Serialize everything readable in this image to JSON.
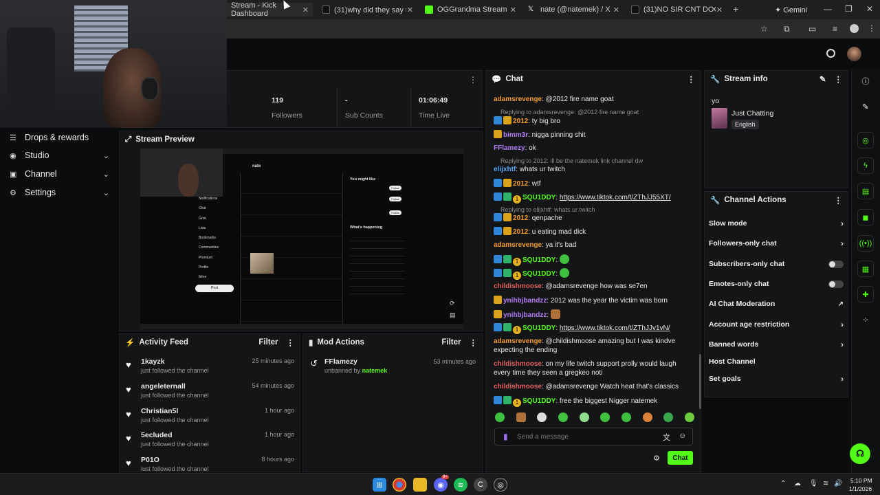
{
  "browser": {
    "tabs": [
      {
        "label": "Stream - Kick Dashboard",
        "icon": "kick-icon"
      },
      {
        "label": "(31)why did they say that 😂",
        "icon": "tiktok-icon"
      },
      {
        "label": "OGGrandma Stream - Watch",
        "icon": "kick-icon"
      },
      {
        "label": "nate (@natemek) / X",
        "icon": "x-icon"
      },
      {
        "label": "(31)NO SIR CNT DOOO | no",
        "icon": "tiktok-icon"
      }
    ],
    "gemini_label": "Gemini"
  },
  "sidebar": {
    "items": [
      {
        "label": "Drops & rewards",
        "icon": "gift-icon"
      },
      {
        "label": "Studio",
        "icon": "studio-icon"
      },
      {
        "label": "Channel",
        "icon": "channel-icon"
      },
      {
        "label": "Settings",
        "icon": "gear-icon"
      }
    ]
  },
  "stats": {
    "followers_value": "119",
    "followers_label": "Followers",
    "subs_value": "-",
    "subs_label": "Sub Counts",
    "time_value": "01:06:49",
    "time_label": "Time Live"
  },
  "stream_preview": {
    "title": "Stream Preview",
    "preview_profile_name": "nate",
    "preview_menu": [
      "Notifications",
      "Chat",
      "Grok",
      "Lists",
      "Bookmarks",
      "Communities",
      "Premium",
      "Profile",
      "More"
    ],
    "preview_post_button": "Post",
    "preview_you_might_like": "You might like",
    "preview_whats_happening": "What's happening",
    "preview_follow": "Follow"
  },
  "activity_feed": {
    "title": "Activity Feed",
    "filter_label": "Filter",
    "items": [
      {
        "name": "1kayzk",
        "action": "just followed the channel",
        "time": "25 minutes ago"
      },
      {
        "name": "angeleternall",
        "action": "just followed the channel",
        "time": "54 minutes ago"
      },
      {
        "name": "Christian5l",
        "action": "just followed the channel",
        "time": "1 hour ago"
      },
      {
        "name": "5ecluded",
        "action": "just followed the channel",
        "time": "1 hour ago"
      },
      {
        "name": "P01O",
        "action": "just followed the channel",
        "time": "8 hours ago"
      }
    ]
  },
  "mod_actions": {
    "title": "Mod Actions",
    "filter_label": "Filter",
    "items": [
      {
        "name": "FFlamezy",
        "action_prefix": "unbanned by",
        "moderator": "natemek",
        "time": "53 minutes ago"
      }
    ]
  },
  "chat": {
    "title": "Chat",
    "send_placeholder": "Send a message",
    "chat_button": "Chat",
    "messages": {
      "m1_user": "adamsrevenge",
      "m1_text": ": @2012 fire name goat",
      "m2_reply": "Replying to adamsrevenge: @2012 fire name goat",
      "m2_user": "2012",
      "m2_text": ": ty big bro",
      "m3_user": "bimm3r",
      "m3_text": ": nigga pinning shit",
      "m4_user": "FFlamezy",
      "m4_text": ": ok",
      "m5_reply": "Replying to 2012: ill be the natemek link channel dw",
      "m5_user": "elijxhtf",
      "m5_text": ": whats ur twitch",
      "m6_user": "2012",
      "m6_text": ": wtf",
      "m7_sub": "1",
      "m7_user": "SQU1DDY",
      "m7_link": "https://www.tiktok.com/t/ZThJJ55XT/",
      "m8_reply": "Replying to elijxhtf: whats ur twitch",
      "m8_user": "2012",
      "m8_text": ": qenpache",
      "m9_user": "2012",
      "m9_text": ": u eating mad dick",
      "m10_user": "adamsrevenge",
      "m10_text": ": ya it's bad",
      "m11_sub": "1",
      "m11_user": "SQU1DDY",
      "m12_sub": "1",
      "m12_user": "SQU1DDY",
      "m13_user": "childishmoose",
      "m13_text": ": @adamsrevenge how was se7en",
      "m14_user": "ynihbjbandzz",
      "m14_text": ": 2012 was the year the victim was born",
      "m15_user": "ynihbjbandzz",
      "m16_sub": "1",
      "m16_user": "SQU1DDY",
      "m16_link": "https://www.tiktok.com/t/ZThJJv1vN/",
      "m17_user": "adamsrevenge",
      "m17_text": ": @childishmoose amazing but I was kindve expecting the ending",
      "m18_user": "childishmoose",
      "m18_text": ": on my life twitch support prolly would laugh every time they seen a gregkeo noti",
      "m19_user": "childishmoose",
      "m19_text": ": @adamsrevenge Watch heat that's classics",
      "m20_sub": "1",
      "m20_user": "SQU1DDY",
      "m20_text": ": free the biggest Nigger natemek"
    }
  },
  "stream_info": {
    "title": "Stream info",
    "stream_title": "yo",
    "category": "Just Chatting",
    "language_tag": "English"
  },
  "channel_actions": {
    "title": "Channel Actions",
    "rows": [
      "Slow mode",
      "Followers-only chat",
      "Subscribers-only chat",
      "Emotes-only chat",
      "AI Chat Moderation",
      "Account age restriction",
      "Banned words",
      "Host Channel",
      "Set goals"
    ]
  },
  "taskbar": {
    "time": "5:10 PM",
    "date": "1/1/2026",
    "discord_badge": "9+"
  },
  "colors": {
    "accent": "#53fc18",
    "panel_bg": "#141517",
    "page_bg": "#0b0c0d"
  }
}
